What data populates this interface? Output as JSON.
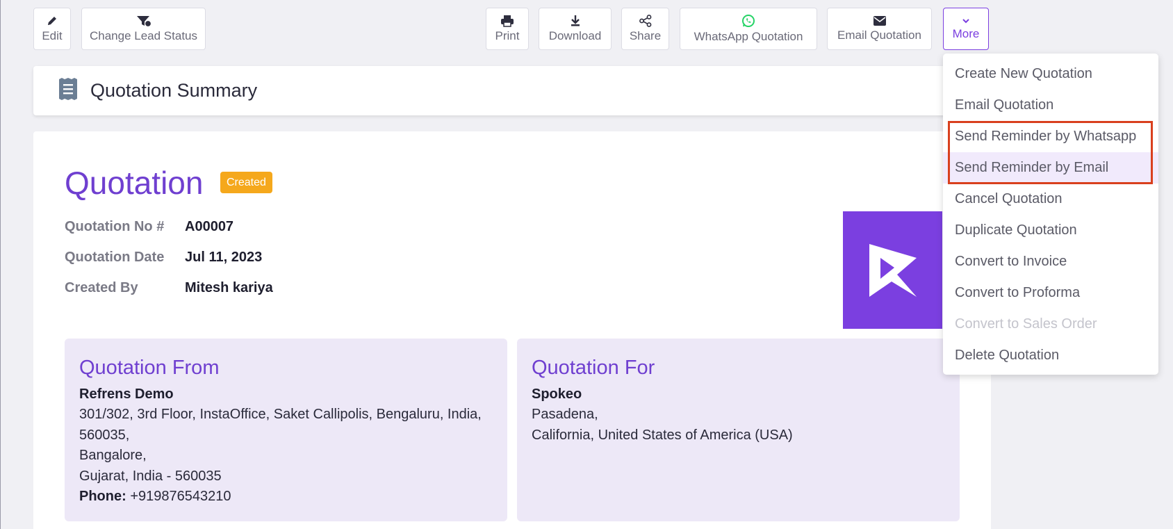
{
  "toolbar": {
    "edit": "Edit",
    "change_lead_status": "Change Lead Status",
    "print": "Print",
    "download": "Download",
    "share": "Share",
    "whatsapp_quotation": "WhatsApp Quotation",
    "email_quotation": "Email Quotation",
    "more": "More"
  },
  "summary": {
    "title": "Quotation Summary"
  },
  "quotation": {
    "title": "Quotation",
    "status": "Created",
    "meta": [
      {
        "label": "Quotation No #",
        "value": "A00007"
      },
      {
        "label": "Quotation Date",
        "value": "Jul 11, 2023"
      },
      {
        "label": "Created By",
        "value": "Mitesh kariya"
      }
    ]
  },
  "from": {
    "heading": "Quotation From",
    "name": "Refrens Demo",
    "lines": [
      "301/302, 3rd Floor, InstaOffice, Saket Callipolis, Bengaluru, India,",
      "560035,",
      "Bangalore,",
      "Gujarat, India - 560035"
    ],
    "phone_label": "Phone:",
    "phone": "+919876543210"
  },
  "for": {
    "heading": "Quotation For",
    "name": "Spokeo",
    "lines": [
      "Pasadena,",
      "California, United States of America (USA)"
    ]
  },
  "more_menu": {
    "items": [
      {
        "label": "Create New Quotation"
      },
      {
        "label": "Email Quotation"
      },
      {
        "label": "Send Reminder by Whatsapp"
      },
      {
        "label": "Send Reminder by Email"
      },
      {
        "label": "Cancel Quotation"
      },
      {
        "label": "Duplicate Quotation"
      },
      {
        "label": "Convert to Invoice"
      },
      {
        "label": "Convert to Proforma"
      },
      {
        "label": "Convert to Sales Order"
      },
      {
        "label": "Delete Quotation"
      }
    ]
  },
  "colors": {
    "brand": "#7b3fe0",
    "badge": "#f5a81c",
    "highlight": "#d9401e",
    "whatsapp": "#25d366"
  }
}
